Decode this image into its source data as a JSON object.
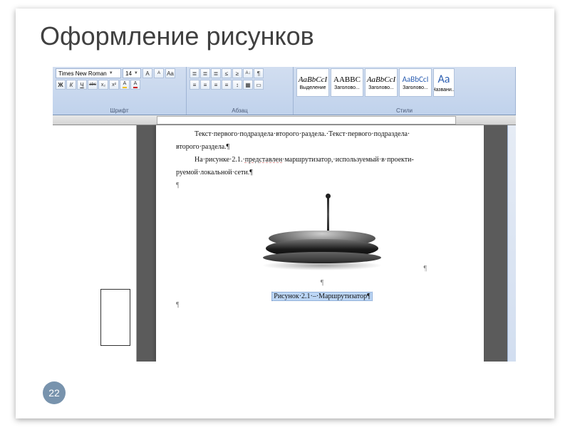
{
  "slide": {
    "title": "Оформление рисунков",
    "page_number": "22"
  },
  "ribbon": {
    "font": {
      "name": "Times New Roman",
      "size": "14",
      "group_label": "Шрифт",
      "btn_grow": "A",
      "btn_shrink": "A",
      "btn_clear": "Aa",
      "btn_bold": "Ж",
      "btn_italic": "К",
      "btn_underline": "Ч",
      "btn_strike": "abc",
      "btn_sub": "x₂",
      "btn_sup": "x²",
      "btn_highlight": "A",
      "btn_color": "A"
    },
    "paragraph": {
      "group_label": "Абзац",
      "b_bul": "≣",
      "b_num": "≣",
      "b_multi": "≣",
      "b_dedent": "≤",
      "b_indent": "≥",
      "b_sort": "A↓",
      "b_marks": "¶",
      "b_left": "≡",
      "b_center": "≡",
      "b_right": "≡",
      "b_just": "≡",
      "b_spacing": "↕",
      "b_shade": "▦",
      "b_border": "▭"
    },
    "styles": {
      "group_label": "Стили",
      "items": [
        {
          "sample": "AaBbCcI",
          "label": "Выделение",
          "cls": "italic"
        },
        {
          "sample": "AABBC",
          "label": "Заголово...",
          "cls": "smallcap"
        },
        {
          "sample": "AaBbCcI",
          "label": "Заголово...",
          "cls": "italic"
        },
        {
          "sample": "AaBbCcI",
          "label": "Заголово...",
          "cls": "blue"
        },
        {
          "sample": "Aa",
          "label": "Названи...",
          "cls": "cut"
        }
      ]
    }
  },
  "document": {
    "p1": "Текст·первого·подраздела·второго·раздела.·Текст·первого·подраздела·",
    "p1b": "второго·раздела.¶",
    "p2a": "На·рисунке·2.1.·",
    "p2u": "представлен",
    "p2b": "·маршрутизатор,·используемый·в·проекти-",
    "p2c": "руемой·локальной·сети.¶",
    "p_blank": "¶",
    "caption": "Рисунок·2.1·–·Маршрутизатор¶"
  }
}
